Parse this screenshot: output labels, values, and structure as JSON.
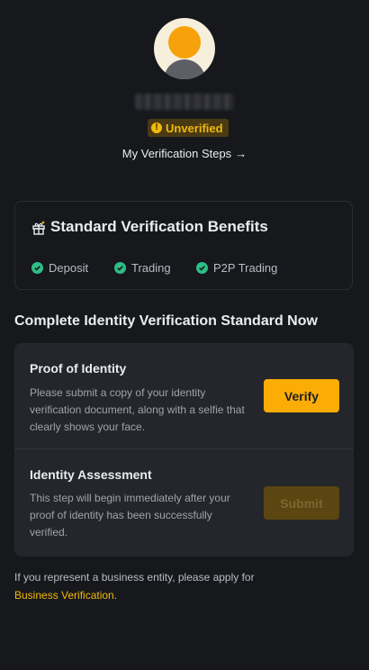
{
  "profile": {
    "status_badge": "Unverified",
    "status_icon": "!",
    "steps_link": "My Verification Steps",
    "steps_arrow": "→"
  },
  "benefits": {
    "title": "Standard Verification Benefits",
    "items": [
      {
        "label": "Deposit"
      },
      {
        "label": "Trading"
      },
      {
        "label": "P2P Trading"
      }
    ]
  },
  "section": {
    "heading": "Complete Identity Verification Standard Now"
  },
  "steps": [
    {
      "title": "Proof of Identity",
      "description": "Please submit a copy of your identity verification document, along with a selfie that clearly shows your face.",
      "button": "Verify",
      "button_enabled": true
    },
    {
      "title": "Identity Assessment",
      "description": "This step will begin immediately after your proof of identity has been successfully verified.",
      "button": "Submit",
      "button_enabled": false
    }
  ],
  "footer": {
    "text": "If you represent a business entity, please apply for",
    "link": "Business Verification",
    "link_suffix": "."
  },
  "colors": {
    "background": "#17181c",
    "card": "#25262b",
    "accent": "#fcad05",
    "success": "#2ebd85",
    "warning": "#f0b90b"
  }
}
